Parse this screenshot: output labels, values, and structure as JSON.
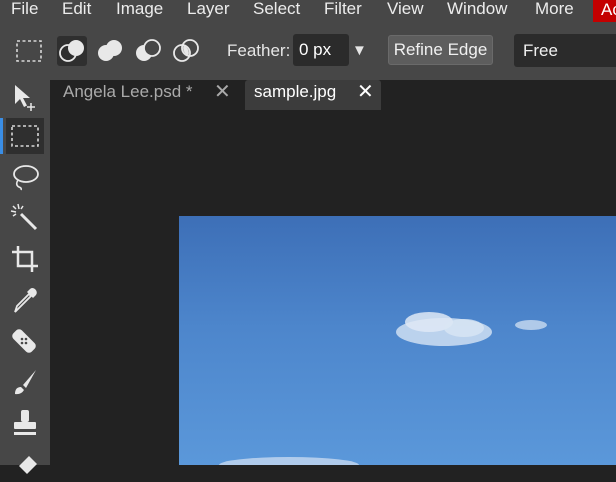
{
  "menu": {
    "items": [
      "File",
      "Edit",
      "Image",
      "Layer",
      "Select",
      "Filter",
      "View",
      "Window",
      "More"
    ],
    "account_label": "Ac"
  },
  "options": {
    "selection_modes": [
      "rectangle-select-icon",
      "new-selection-icon",
      "add-selection-icon",
      "subtract-selection-icon",
      "intersect-selection-icon"
    ],
    "feather_label": "Feather:",
    "feather_value": "0 px",
    "refine_edge_label": "Refine Edge",
    "mode_value": "Free"
  },
  "tools": [
    "move-tool-icon",
    "rectangle-select-tool-icon",
    "lasso-tool-icon",
    "magic-wand-tool-icon",
    "crop-tool-icon",
    "eyedropper-tool-icon",
    "healing-brush-tool-icon",
    "brush-tool-icon",
    "clone-stamp-tool-icon",
    "eraser-tool-icon"
  ],
  "tabs": [
    {
      "label": "Angela Lee.psd *",
      "close": "✕",
      "active": false
    },
    {
      "label": "sample.jpg",
      "close": "✕",
      "active": true
    }
  ],
  "colors": {
    "panel": "#474747",
    "workspace": "#222222",
    "active_tab": "#3c3c3c",
    "accent": "#3a8ee6",
    "account_red": "#c40000",
    "sky": "#4d86cc"
  }
}
